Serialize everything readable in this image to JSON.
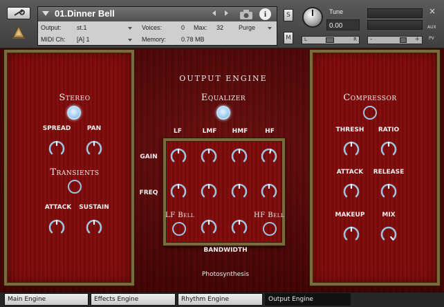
{
  "header": {
    "preset_name": "01.Dinner Bell",
    "output_label": "Output:",
    "output_value": "st.1",
    "voices_label": "Voices:",
    "voices_value": "0",
    "max_label": "Max:",
    "max_value": "32",
    "purge_label": "Purge",
    "midi_label": "MIDI Ch:",
    "midi_value": "[A] 1",
    "memory_label": "Memory:",
    "memory_value": "0.78 MB",
    "solo_label": "S",
    "mute_label": "M",
    "tune_label": "Tune",
    "tune_value": "0.00",
    "pan_left": "L",
    "pan_right": "R",
    "vol_minus": "-",
    "vol_plus": "+",
    "aux_label": "AUX",
    "pv_label": "PV",
    "close_label": "×"
  },
  "engine": {
    "title": "OUTPUT ENGINE",
    "stereo": {
      "heading": "Stereo",
      "spread": "SPREAD",
      "pan": "PAN"
    },
    "transients": {
      "heading": "Transients",
      "attack": "ATTACK",
      "sustain": "SUSTAIN"
    },
    "equalizer": {
      "heading": "Equalizer",
      "bands": [
        "LF",
        "LMF",
        "HMF",
        "HF"
      ],
      "gain": "GAIN",
      "freq": "FREQ",
      "lf_bell": "LF Bell",
      "hf_bell": "HF Bell",
      "bandwidth": "BANDWIDTH"
    },
    "compressor": {
      "heading": "Compressor",
      "thresh": "THRESH",
      "ratio": "RATIO",
      "attack": "ATTACK",
      "release": "RELEASE",
      "makeup": "MAKEUP",
      "mix": "MIX"
    },
    "brand": "Photosynthesis"
  },
  "tabs": [
    {
      "label": "Main Engine",
      "active": false
    },
    {
      "label": "Effects Engine",
      "active": false
    },
    {
      "label": "Rhythm Engine",
      "active": false
    },
    {
      "label": "Output Engine",
      "active": true
    }
  ],
  "icons": {
    "wrench": "wrench-icon",
    "logo": "bell-logo-icon",
    "camera": "camera-icon",
    "info": "info-icon"
  },
  "colors": {
    "panel_red": "#800e0e",
    "frame_gold": "#7b6a3e",
    "knob_blue": "#9ec3de",
    "button_on": "#a9d0f0"
  }
}
